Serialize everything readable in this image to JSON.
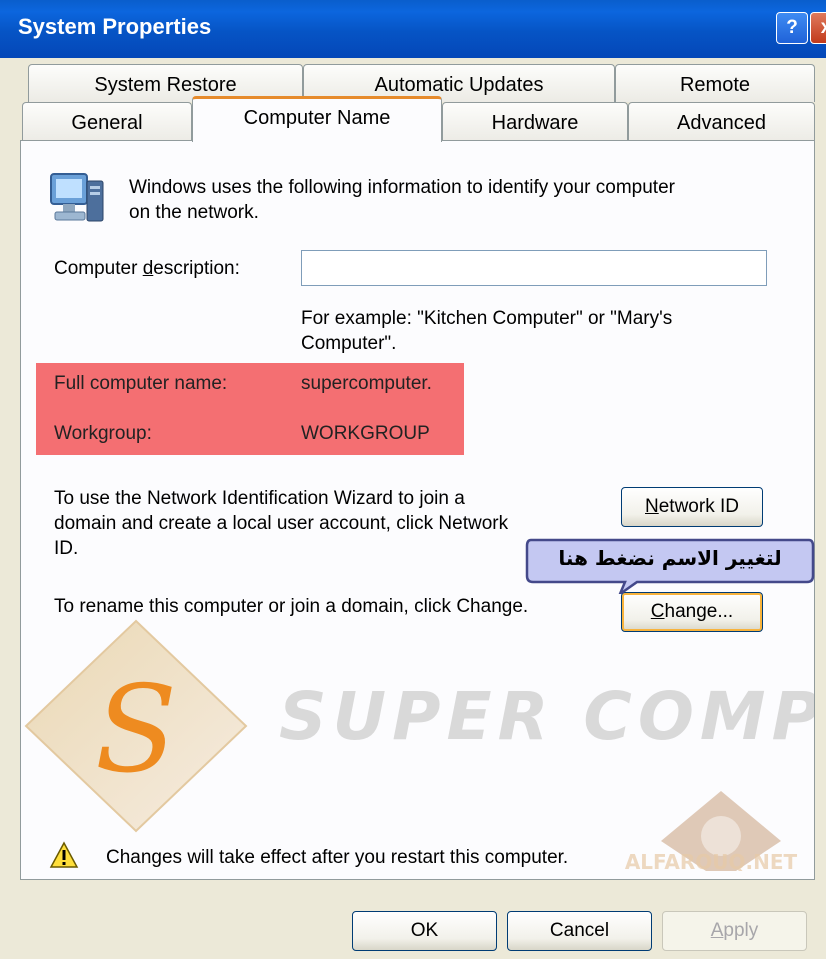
{
  "window": {
    "title": "System Properties",
    "help_label": "?",
    "close_label": "x"
  },
  "tabs_row1": [
    {
      "label": "System Restore"
    },
    {
      "label": "Automatic Updates"
    },
    {
      "label": "Remote"
    }
  ],
  "tabs_row2": [
    {
      "label": "General"
    },
    {
      "label": "Computer Name",
      "active": true
    },
    {
      "label": "Hardware"
    },
    {
      "label": "Advanced"
    }
  ],
  "intro": {
    "line1": "Windows uses the following information to identify your computer",
    "line2": "on the network."
  },
  "description": {
    "label_pre": "Computer ",
    "label_ul": "d",
    "label_post": "escription:",
    "value": "",
    "example_line1": "For example: \"Kitchen Computer\" or \"Mary's",
    "example_line2": "Computer\"."
  },
  "identity": {
    "full_name_label": "Full computer name:",
    "full_name_value": "supercomputer.",
    "workgroup_label": "Workgroup:",
    "workgroup_value": "WORKGROUP"
  },
  "network_id": {
    "text_line1": "To use the Network Identification Wizard to join a",
    "text_line2": "domain and create a local user account, click Network",
    "text_line3": "ID.",
    "button_ul": "N",
    "button_rest": "etwork ID"
  },
  "callout": {
    "text": "لتغيير الاسم نضغط هنا"
  },
  "change": {
    "text": "To rename this computer or join a domain, click Change.",
    "button_ul": "C",
    "button_rest": "hange..."
  },
  "watermark": {
    "logo_letter": "S",
    "brand": "SUPER COMPUTER",
    "site": "ALFAROUQ.NET"
  },
  "warning": {
    "text": "Changes will take effect after you restart this computer."
  },
  "footer": {
    "ok_label": "OK",
    "cancel_label": "Cancel",
    "apply_ul": "A",
    "apply_rest": "pply"
  },
  "colors": {
    "highlight": "#f46f72",
    "titlebar": "#0654c5",
    "active_tab_accent": "#e68b2c"
  }
}
